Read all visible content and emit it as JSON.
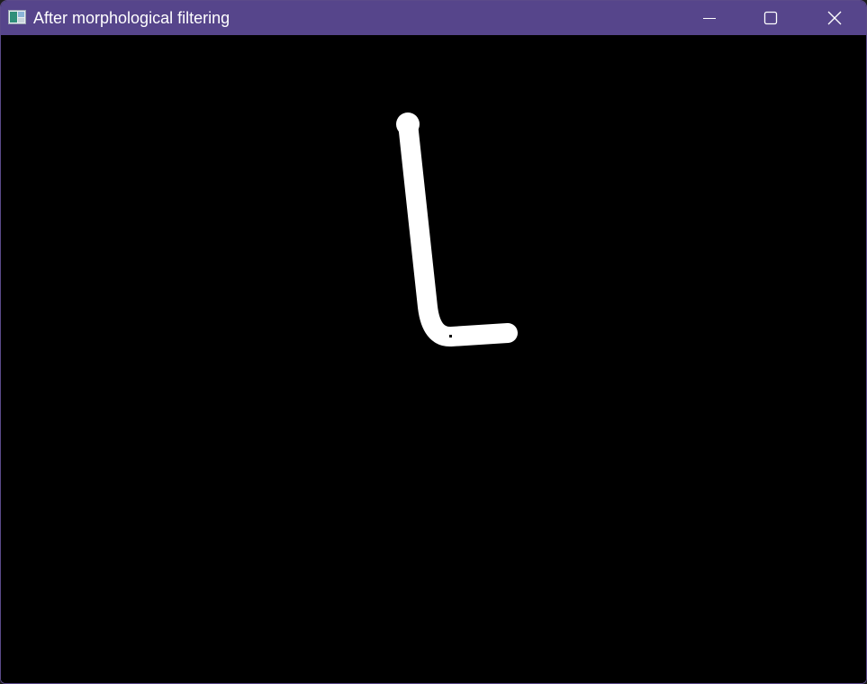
{
  "window": {
    "title": "After morphological filtering",
    "titlebar_color": "#56458b",
    "icons": {
      "app": "image-window-icon",
      "minimize": "minimize-icon",
      "maximize": "maximize-icon",
      "close": "close-icon"
    }
  },
  "image": {
    "background_color": "#000000",
    "foreground_color": "#ffffff",
    "content": "binary mask of a hand-drawn L-shaped stroke"
  }
}
